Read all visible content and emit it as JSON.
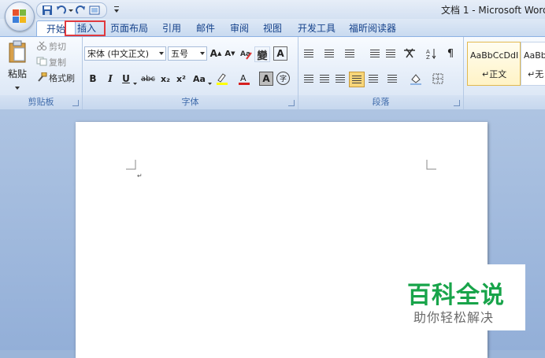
{
  "window": {
    "title": "文档 1 - Microsoft Word"
  },
  "tabs": [
    {
      "label": "开始",
      "active": true
    },
    {
      "label": "插入",
      "highlighted": true
    },
    {
      "label": "页面布局"
    },
    {
      "label": "引用"
    },
    {
      "label": "邮件"
    },
    {
      "label": "审阅"
    },
    {
      "label": "视图"
    },
    {
      "label": "开发工具"
    },
    {
      "label": "福昕阅读器"
    }
  ],
  "clipboard": {
    "paste": "粘贴",
    "cut": "剪切",
    "copy": "复制",
    "format_painter": "格式刷",
    "label": "剪贴板"
  },
  "font": {
    "name": "宋体 (中文正文)",
    "size": "五号",
    "label": "字体",
    "phonetic_glyph": "變",
    "bold": "B",
    "italic": "I",
    "underline": "U",
    "strike": "abc",
    "subscript": "x₂",
    "superscript": "x²",
    "case": "Aa",
    "grow": "A",
    "shrink": "A",
    "char_border": "A",
    "char_shading": "A",
    "enclose": "字"
  },
  "paragraph": {
    "label": "段落"
  },
  "styles": {
    "sample1": "AaBbCcDdI",
    "sample1_label": "正文",
    "sample2": "AaBbC",
    "sample2_label": "无"
  },
  "watermark": {
    "title": "百科全说",
    "subtitle": "助你轻松解决"
  },
  "colors": {
    "highlight_border": "#e0393e",
    "watermark_green": "#18a44a",
    "tab_text": "#15428b"
  }
}
